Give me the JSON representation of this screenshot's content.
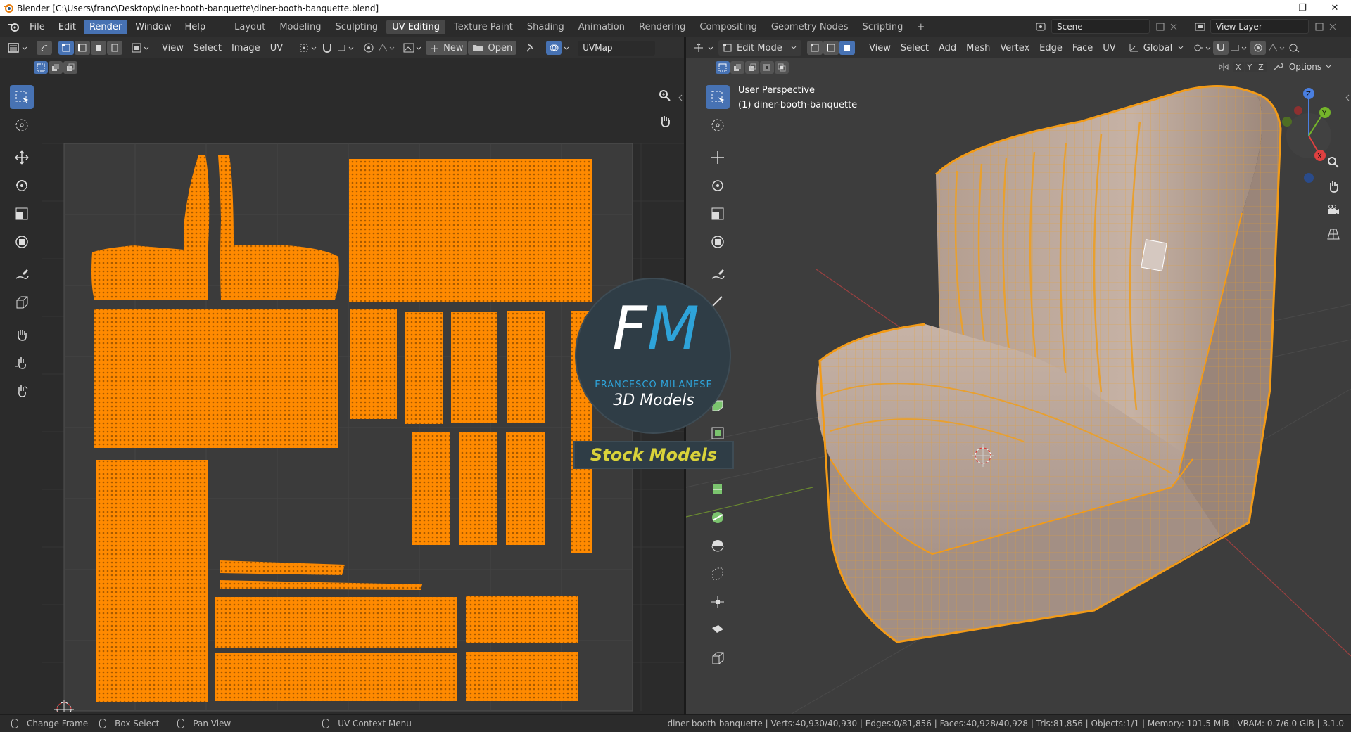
{
  "window": {
    "title": "Blender [C:\\Users\\franc\\Desktop\\diner-booth-banquette\\diner-booth-banquette.blend]",
    "minimize": "—",
    "restore": "❐",
    "close": "✕"
  },
  "menu": [
    "File",
    "Edit",
    "Render",
    "Window",
    "Help"
  ],
  "workspaces": [
    "Layout",
    "Modeling",
    "Sculpting",
    "UV Editing",
    "Texture Paint",
    "Shading",
    "Animation",
    "Rendering",
    "Compositing",
    "Geometry Nodes",
    "Scripting"
  ],
  "scene": "Scene",
  "view_layer": "View Layer",
  "add_workspace": "+",
  "uv_header": {
    "menus": [
      "View",
      "Select",
      "Image",
      "UV"
    ],
    "new_label": "New",
    "open_label": "Open",
    "uvmap": "UVMap"
  },
  "vp_header": {
    "mode": "Edit Mode",
    "menus": [
      "View",
      "Select",
      "Add",
      "Mesh",
      "Vertex",
      "Edge",
      "Face",
      "UV"
    ],
    "orientation": "Global",
    "axes": [
      "X",
      "Y",
      "Z"
    ],
    "options": "Options"
  },
  "viewport": {
    "perspective": "User Perspective",
    "object": "(1) diner-booth-banquette"
  },
  "watermark": {
    "initials": "FM",
    "name": "FRANCESCO MILANESE",
    "sub": "3D Models",
    "banner": "Stock Models"
  },
  "status": {
    "items": [
      "Change Frame",
      "Box Select",
      "Pan View",
      "UV Context Menu"
    ],
    "stats": "diner-booth-banquette | Verts:40,930/40,930 | Edges:0/81,856 | Faces:40,928/40,928 | Tris:81,856 | Objects:1/1 | Memory: 101.5 MiB | VRAM: 0.7/6.0 GiB | 3.1.0"
  },
  "colors": {
    "accent": "#4772b3",
    "uv_islands": "#ff8a00",
    "mesh_wire": "#f0a020",
    "bg": "#2b2b2b"
  }
}
